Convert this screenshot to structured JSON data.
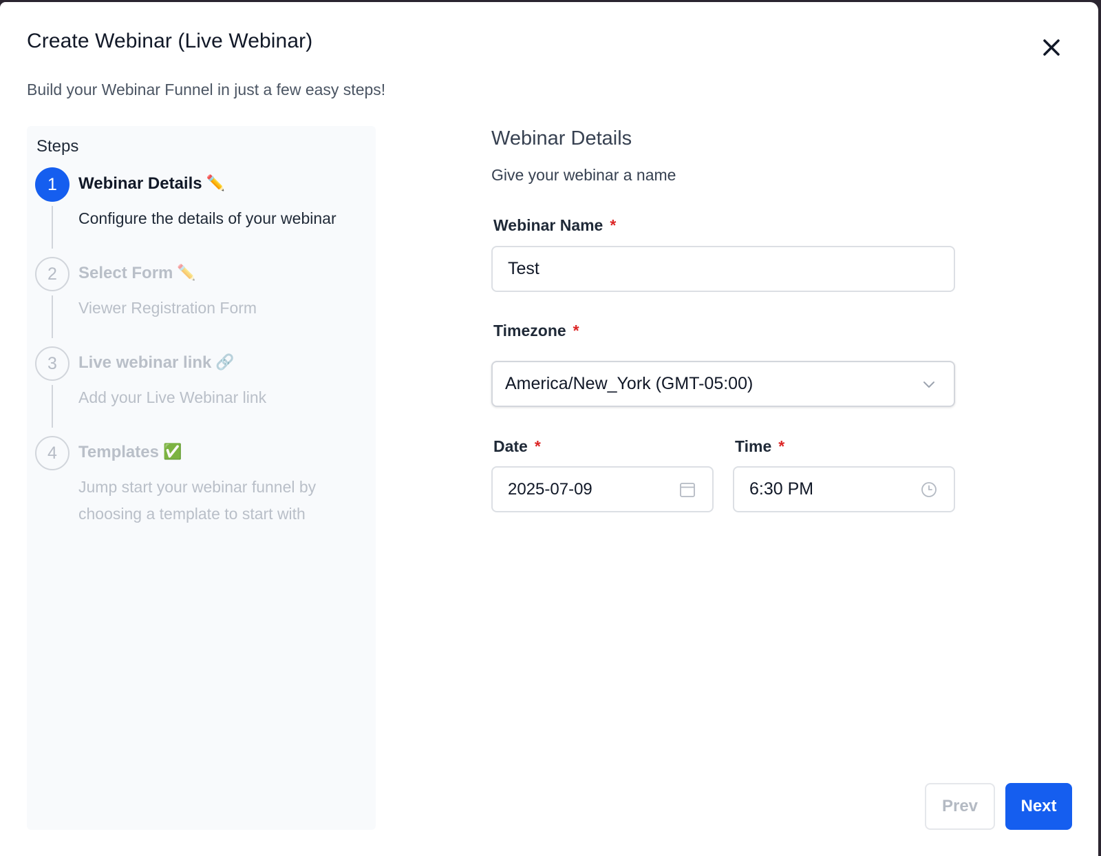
{
  "modal": {
    "title": "Create Webinar (Live Webinar)",
    "subtitle": "Build your Webinar Funnel in just a few easy steps!",
    "close_icon": "close-icon"
  },
  "steps": {
    "heading": "Steps",
    "items": [
      {
        "number": "1",
        "title": "Webinar Details",
        "emoji": "✏️",
        "description": "Configure the details of your webinar",
        "state": "active"
      },
      {
        "number": "2",
        "title": "Select Form",
        "emoji": "✏️",
        "description": "Viewer Registration Form",
        "state": "inactive"
      },
      {
        "number": "3",
        "title": "Live webinar link",
        "emoji": "🔗",
        "description": "Add your Live Webinar link",
        "state": "inactive"
      },
      {
        "number": "4",
        "title": "Templates",
        "emoji": "✅",
        "description": "Jump start your webinar funnel by choosing a template to start with",
        "state": "inactive"
      }
    ]
  },
  "form": {
    "title": "Webinar Details",
    "subtitle": "Give your webinar a name",
    "webinar_name": {
      "label": "Webinar Name",
      "required": "*",
      "value": "Test"
    },
    "timezone": {
      "label": "Timezone",
      "required": "*",
      "value": "America/New_York (GMT-05:00)",
      "icon": "chevron-down-icon"
    },
    "date": {
      "label": "Date",
      "required": "*",
      "value": "2025-07-09",
      "icon": "calendar-icon"
    },
    "time": {
      "label": "Time",
      "required": "*",
      "value": "6:30 PM",
      "icon": "clock-icon"
    }
  },
  "footer": {
    "prev_label": "Prev",
    "next_label": "Next"
  },
  "colors": {
    "accent": "#155eef",
    "required": "#dc2626",
    "inactive_text": "#b9bfc8",
    "panel_bg": "#f8fafc"
  }
}
